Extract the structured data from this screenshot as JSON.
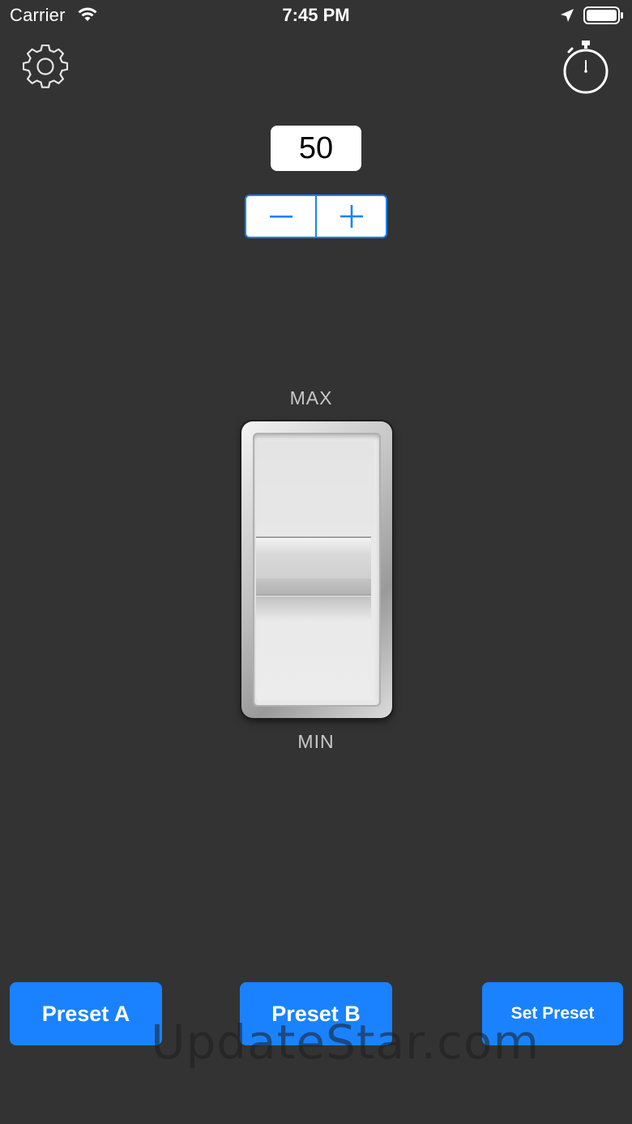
{
  "status_bar": {
    "carrier": "Carrier",
    "time": "7:45 PM"
  },
  "icons": {
    "settings": "gear-icon",
    "timer": "stopwatch-icon",
    "wifi": "wifi-icon",
    "location": "location-arrow-icon",
    "battery": "battery-icon"
  },
  "level": {
    "value": "50",
    "decrement_label": "−",
    "increment_label": "+"
  },
  "switch": {
    "max_label": "MAX",
    "min_label": "MIN",
    "level_percent": 50
  },
  "buttons": {
    "preset_a": "Preset A",
    "preset_b": "Preset B",
    "set_preset": "Set Preset"
  },
  "watermark": "UpdateStar.com",
  "colors": {
    "background": "#333333",
    "accent": "#1a82ff"
  }
}
